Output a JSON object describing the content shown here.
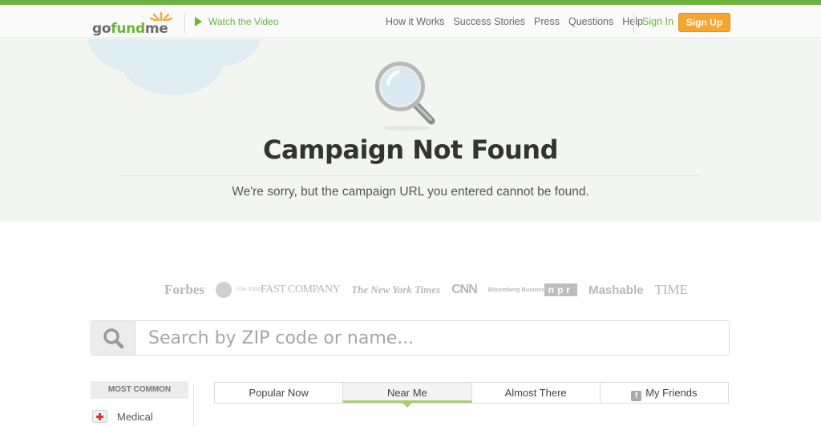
{
  "header": {
    "logo": "gofundme",
    "watch_video": "Watch the Video",
    "nav": [
      "How it Works",
      "Success Stories",
      "Press",
      "Questions",
      "Help"
    ],
    "sign_in": "Sign In",
    "sign_up": "Sign Up"
  },
  "hero": {
    "title": "Campaign Not Found",
    "message": "We're sorry, but the campaign URL you entered cannot be found."
  },
  "press_logos": [
    "Forbes",
    "USA TODAY",
    "FAST COMPANY",
    "The New York Times",
    "CNN",
    "Bloomberg Businessweek",
    "npr",
    "Mashable",
    "TIME"
  ],
  "search": {
    "placeholder": "Search by ZIP code or name..."
  },
  "categories": {
    "heading": "MOST COMMON",
    "items": [
      "Medical"
    ]
  },
  "tabs": [
    "Popular Now",
    "Near Me",
    "Almost There",
    "My Friends"
  ],
  "active_tab": "Near Me",
  "colors": {
    "brand_green": "#6cb33e",
    "signup_orange": "#f6a630"
  }
}
